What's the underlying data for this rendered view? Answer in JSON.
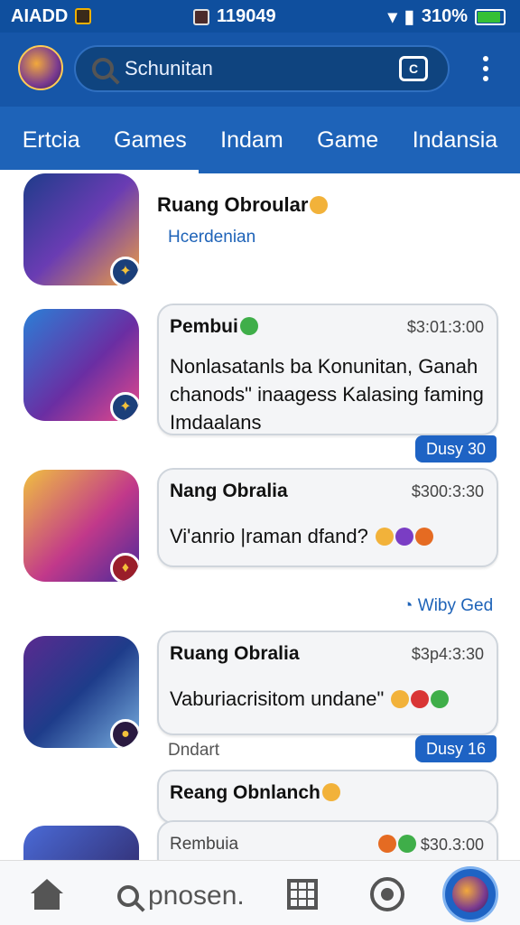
{
  "status": {
    "left": "AIADD",
    "time": "119049",
    "battery": "310%"
  },
  "appbar": {
    "search_text": "Schunitan",
    "camera_label": "C"
  },
  "tabs": [
    "Ertcia",
    "Games",
    "Indam",
    "Game",
    "Indansia"
  ],
  "feed": {
    "item1": {
      "name": "Ruang Obroular",
      "sub": "Hcerdenian"
    },
    "item2": {
      "name": "Pembui",
      "time": "$3:01:3:00",
      "msg": "Nonlasatanls ba Konunitan, Ganah\nchanods\" inaagess Kalasing faming\nImdaalans",
      "pill": "Dusy 30"
    },
    "item3": {
      "name": "Nang Obralia",
      "time": "$300:3:30",
      "msg": "Vi'anrio |raman dfand?",
      "meta": "Wiby Ged"
    },
    "item4": {
      "name": "Ruang Obralia",
      "time": "$3p4:3:30",
      "msg": "Vaburiacrisitom undane\"",
      "label": "Dndart",
      "pill": "Dusy 16"
    },
    "item5": {
      "name": "Reang Obnlanch",
      "sub": "Rembuia",
      "time": "$30.3:00"
    }
  },
  "bottom_nav": {
    "search_label": "pnosen."
  },
  "colors": {
    "primary": "#1656a8",
    "tabs": "#1e63b8",
    "pill": "#1e63c4"
  }
}
